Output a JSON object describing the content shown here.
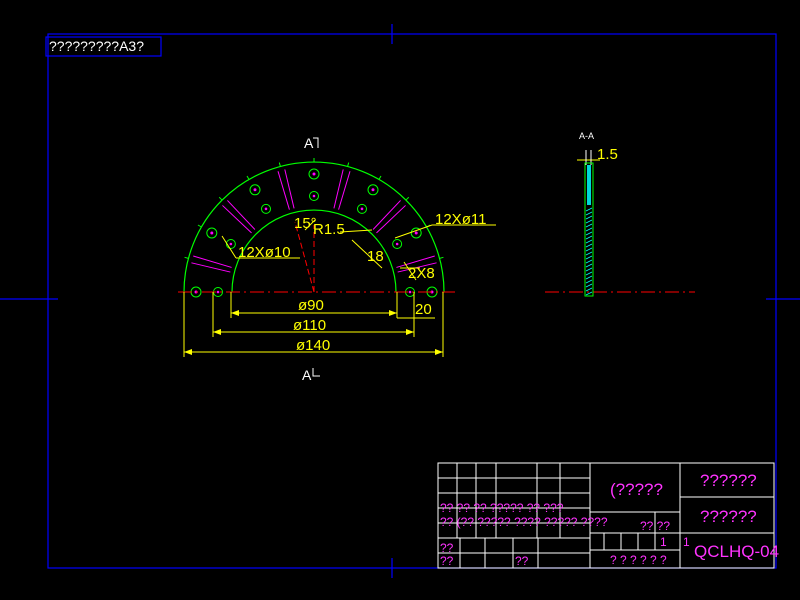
{
  "colors": {
    "background": "#000000",
    "frame": "#0000ff",
    "geometry": "#00ff00",
    "dimension": "#ffff00",
    "centerline": "#ff0000",
    "title_text": "#ff33ff",
    "section_fill": "#00ffff",
    "hatch": "#ff00ff"
  },
  "header_note": "?????????A3?",
  "section_label_top": "A",
  "section_label_bottom": "A",
  "section_view_label": "A-A",
  "dimensions": {
    "angle": "15°",
    "radius": "R1.5",
    "angle_cut": "18",
    "holes_outer": "12Xø11",
    "holes_inner": "12Xø10",
    "slots": "2X8",
    "dia_inner": "ø90",
    "dia_mid": "ø110",
    "dia_outer": "ø140",
    "width": "20",
    "thickness": "1.5"
  },
  "title_block": {
    "part_name_a": "(?????",
    "part_name_b": "??????",
    "part_name_c": "??????",
    "drawing_number": "QCLHQ-04",
    "row1": "?? ?? ?? ????? ?? ???",
    "row2": "?? (?? ????? ???? ????? ????",
    "row2_right": "?? ??",
    "row3": "??",
    "row4_left": "??",
    "row4_mid": "??",
    "scale_left": "1",
    "scale_right": "1",
    "sheet_info": "? ? ? ? ? ?"
  }
}
